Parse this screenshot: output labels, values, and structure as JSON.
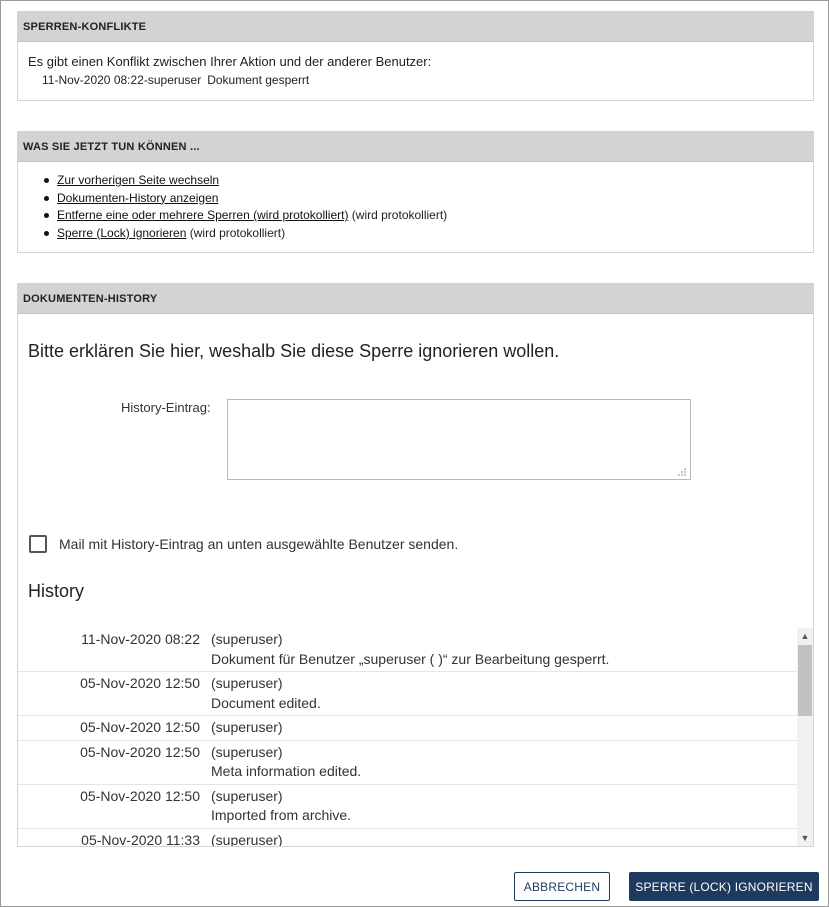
{
  "conflicts": {
    "header": "SPERREN-KONFLIKTE",
    "message": "Es gibt einen Konflikt zwischen Ihrer Aktion und der anderer Benutzer:",
    "entry_time_user": "11-Nov-2020 08:22-superuser",
    "entry_status": "Dokument gesperrt"
  },
  "actions": {
    "header": "WAS SIE JETZT TUN KÖNNEN ...",
    "items": [
      {
        "link": "Zur vorherigen Seite wechseln",
        "note": ""
      },
      {
        "link": "Dokumenten-History anzeigen",
        "note": ""
      },
      {
        "link": "Entferne eine oder mehrere Sperren (wird protokolliert)",
        "note": " (wird protokolliert)"
      },
      {
        "link": "Sperre (Lock) ignorieren",
        "note": " (wird protokolliert)"
      }
    ]
  },
  "history_section": {
    "header": "DOKUMENTEN-HISTORY",
    "explain": "Bitte erklären Sie hier, weshalb Sie diese Sperre ignorieren wollen.",
    "entry_label": "History-Eintrag:",
    "entry_value": "",
    "mail_label": "Mail mit History-Eintrag an unten ausgewählte Benutzer senden.",
    "mail_checked": false,
    "history_title": "History",
    "rows": [
      {
        "date": "11-Nov-2020 08:22",
        "user": "(superuser)",
        "text": "Dokument für Benutzer „superuser ( )“ zur Bearbeitung gesperrt."
      },
      {
        "date": "05-Nov-2020 12:50",
        "user": "(superuser)",
        "text": "Document edited."
      },
      {
        "date": "05-Nov-2020 12:50",
        "user": "(superuser)",
        "text": ""
      },
      {
        "date": "05-Nov-2020 12:50",
        "user": "(superuser)",
        "text": "Meta information edited."
      },
      {
        "date": "05-Nov-2020 12:50",
        "user": "(superuser)",
        "text": "Imported from archive."
      },
      {
        "date": "05-Nov-2020 11:33",
        "user": "(superuser)",
        "text": ""
      }
    ]
  },
  "buttons": {
    "cancel": "ABBRECHEN",
    "ignore": "SPERRE (LOCK) IGNORIEREN"
  },
  "colors": {
    "header_bg": "#d3d3d3",
    "primary": "#1e3a5f"
  }
}
